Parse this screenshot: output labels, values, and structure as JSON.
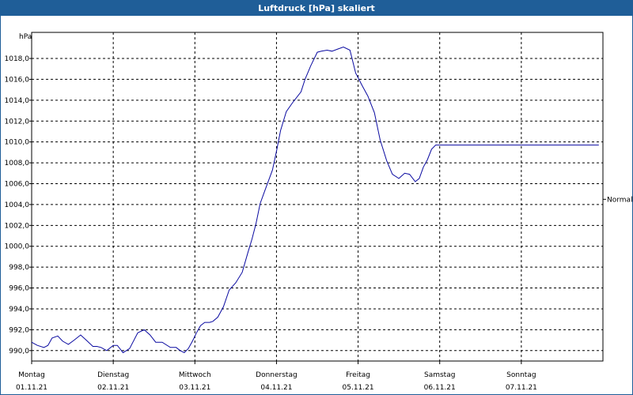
{
  "title": "Luftdruck [hPa] skaliert",
  "chart_data": {
    "type": "line",
    "title": "Luftdruck [hPa] skaliert",
    "ylabel": "hPa",
    "xlabel": "",
    "ylim": [
      989.0,
      1020.5
    ],
    "y_ticks": [
      "990,0",
      "992,0",
      "994,0",
      "996,0",
      "998,0",
      "1000,0",
      "1002,0",
      "1004,0",
      "1006,0",
      "1008,0",
      "1010,0",
      "1012,0",
      "1014,0",
      "1016,0",
      "1018,0"
    ],
    "y_tick_values": [
      990,
      992,
      994,
      996,
      998,
      1000,
      1002,
      1004,
      1006,
      1008,
      1010,
      1012,
      1014,
      1016,
      1018
    ],
    "x_range_days": [
      0,
      7
    ],
    "x_ticks": [
      {
        "day": "Montag",
        "date": "01.11.21"
      },
      {
        "day": "Dienstag",
        "date": "02.11.21"
      },
      {
        "day": "Mittwoch",
        "date": "03.11.21"
      },
      {
        "day": "Donnerstag",
        "date": "04.11.21"
      },
      {
        "day": "Freitag",
        "date": "05.11.21"
      },
      {
        "day": "Samstag",
        "date": "06.11.21"
      },
      {
        "day": "Sonntag",
        "date": "07.11.21"
      }
    ],
    "reference_line": {
      "label": "Normal",
      "value": 1004.5
    },
    "grid": true,
    "colors": {
      "series": "#0a0aa0",
      "title_bar": "#1f5e98",
      "grid": "#000000"
    },
    "series": [
      {
        "x": [
          0.0,
          0.07,
          0.15,
          0.2,
          0.25,
          0.32,
          0.38,
          0.45,
          0.52,
          0.6,
          0.67,
          0.75,
          0.8,
          0.85,
          0.92,
          1.0,
          1.05,
          1.12,
          1.2,
          1.3,
          1.38,
          1.45,
          1.52,
          1.6,
          1.7,
          1.77,
          1.82,
          1.87,
          1.92,
          1.97,
          2.02,
          2.07,
          2.12,
          2.18,
          2.22,
          2.28,
          2.35,
          2.42,
          2.5,
          2.58,
          2.65,
          2.7,
          2.75,
          2.8,
          2.87,
          2.95,
          3.0,
          3.05,
          3.12,
          3.2,
          3.3,
          3.35,
          3.42,
          3.5,
          3.55,
          3.62,
          3.68,
          3.75,
          3.82,
          3.9,
          3.97,
          4.05,
          4.12,
          4.2,
          4.27,
          4.35,
          4.42,
          4.5,
          4.57,
          4.63,
          4.7,
          4.75,
          4.8,
          4.85,
          4.9,
          4.95,
          5.0,
          5.05,
          5.12,
          5.2,
          5.25,
          5.3,
          5.35,
          5.4,
          5.45,
          5.52,
          5.6,
          5.65,
          5.7,
          5.75,
          5.82,
          5.9,
          6.0,
          6.05,
          6.1,
          6.15,
          6.2,
          6.25,
          6.3,
          6.35,
          6.4,
          6.45,
          6.5,
          6.55,
          6.6,
          6.65,
          6.7,
          6.75,
          6.8,
          6.85,
          6.9,
          6.95,
          7.0
        ],
        "y": [
          990.8,
          990.5,
          990.3,
          990.5,
          991.2,
          991.4,
          990.9,
          990.6,
          991.0,
          991.5,
          991.0,
          990.4,
          990.4,
          990.3,
          990.0,
          990.5,
          990.5,
          989.8,
          990.2,
          991.7,
          992.0,
          991.5,
          990.8,
          990.8,
          990.3,
          990.3,
          990.0,
          989.8,
          990.2,
          990.9,
          991.7,
          992.4,
          992.7,
          992.7,
          992.8,
          993.2,
          994.2,
          995.8,
          996.5,
          997.5,
          999.4,
          1000.7,
          1002.2,
          1004.1,
          1005.6,
          1007.3,
          1009.1,
          1011.1,
          1012.9,
          1013.8,
          1014.8,
          1016.0,
          1017.3,
          1018.6,
          1018.7,
          1018.8,
          1018.7,
          1018.9,
          1019.1,
          1018.8,
          1016.6,
          1015.4,
          1014.4,
          1012.8,
          1010.2,
          1008.2,
          1006.9,
          1006.5,
          1007.0,
          1006.9,
          1006.2,
          1006.5,
          1007.6,
          1008.3,
          1009.3,
          1009.7,
          1009.7,
          1009.7,
          1009.7,
          1009.7,
          1009.7,
          1009.7,
          1009.7,
          1009.7,
          1009.7,
          1009.7,
          1009.7,
          1009.7,
          1009.7,
          1009.7,
          1009.7,
          1009.7,
          1009.7,
          1009.7,
          1009.7,
          1009.7,
          1009.7,
          1009.7,
          1009.7,
          1009.7,
          1009.7,
          1009.7,
          1009.7,
          1009.7,
          1009.7,
          1009.7,
          1009.7,
          1009.7,
          1009.7,
          1009.7,
          1009.7,
          1009.7,
          1009.7
        ]
      }
    ]
  }
}
